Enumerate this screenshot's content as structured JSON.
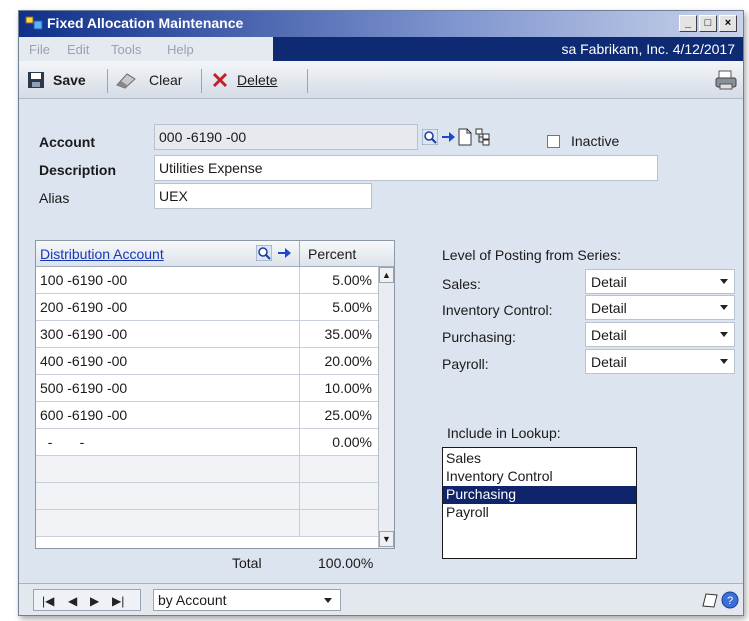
{
  "window": {
    "title": "Fixed Allocation Maintenance"
  },
  "menu": {
    "items": [
      "File",
      "Edit",
      "Tools",
      "Help"
    ],
    "company": "sa  Fabrikam, Inc.  4/12/2017"
  },
  "toolbar": {
    "save": "Save",
    "clear": "Clear",
    "delete": "Delete"
  },
  "form": {
    "account_label": "Account",
    "account_value": "000 -6190 -00",
    "inactive_label": "Inactive",
    "description_label": "Description",
    "description_value": "Utilities Expense",
    "alias_label": "Alias",
    "alias_value": "UEX"
  },
  "grid": {
    "col_account": "Distribution Account",
    "col_percent": "Percent",
    "rows": [
      {
        "account": "100 -6190 -00",
        "percent": "5.00%"
      },
      {
        "account": "200 -6190 -00",
        "percent": "5.00%"
      },
      {
        "account": "300 -6190 -00",
        "percent": "35.00%"
      },
      {
        "account": "400 -6190 -00",
        "percent": "20.00%"
      },
      {
        "account": "500 -6190 -00",
        "percent": "10.00%"
      },
      {
        "account": "600 -6190 -00",
        "percent": "25.00%"
      },
      {
        "account": "  -       -",
        "percent": "0.00%"
      },
      {
        "account": "",
        "percent": ""
      },
      {
        "account": "",
        "percent": ""
      },
      {
        "account": "",
        "percent": ""
      }
    ],
    "total_label": "Total",
    "total_value": "100.00%"
  },
  "posting": {
    "heading": "Level of Posting from Series:",
    "rows": [
      {
        "label": "Sales:",
        "value": "Detail"
      },
      {
        "label": "Inventory Control:",
        "value": "Detail"
      },
      {
        "label": "Purchasing:",
        "value": "Detail"
      },
      {
        "label": "Payroll:",
        "value": "Detail"
      }
    ]
  },
  "lookup": {
    "heading": "Include in Lookup:",
    "items": [
      "Sales",
      "Inventory Control",
      "Purchasing",
      "Payroll"
    ],
    "selected_index": 2
  },
  "status": {
    "sort": "by Account"
  },
  "colors": {
    "title_bar": "#0f2f8a",
    "selection": "#10246b",
    "link": "#1738b8"
  }
}
